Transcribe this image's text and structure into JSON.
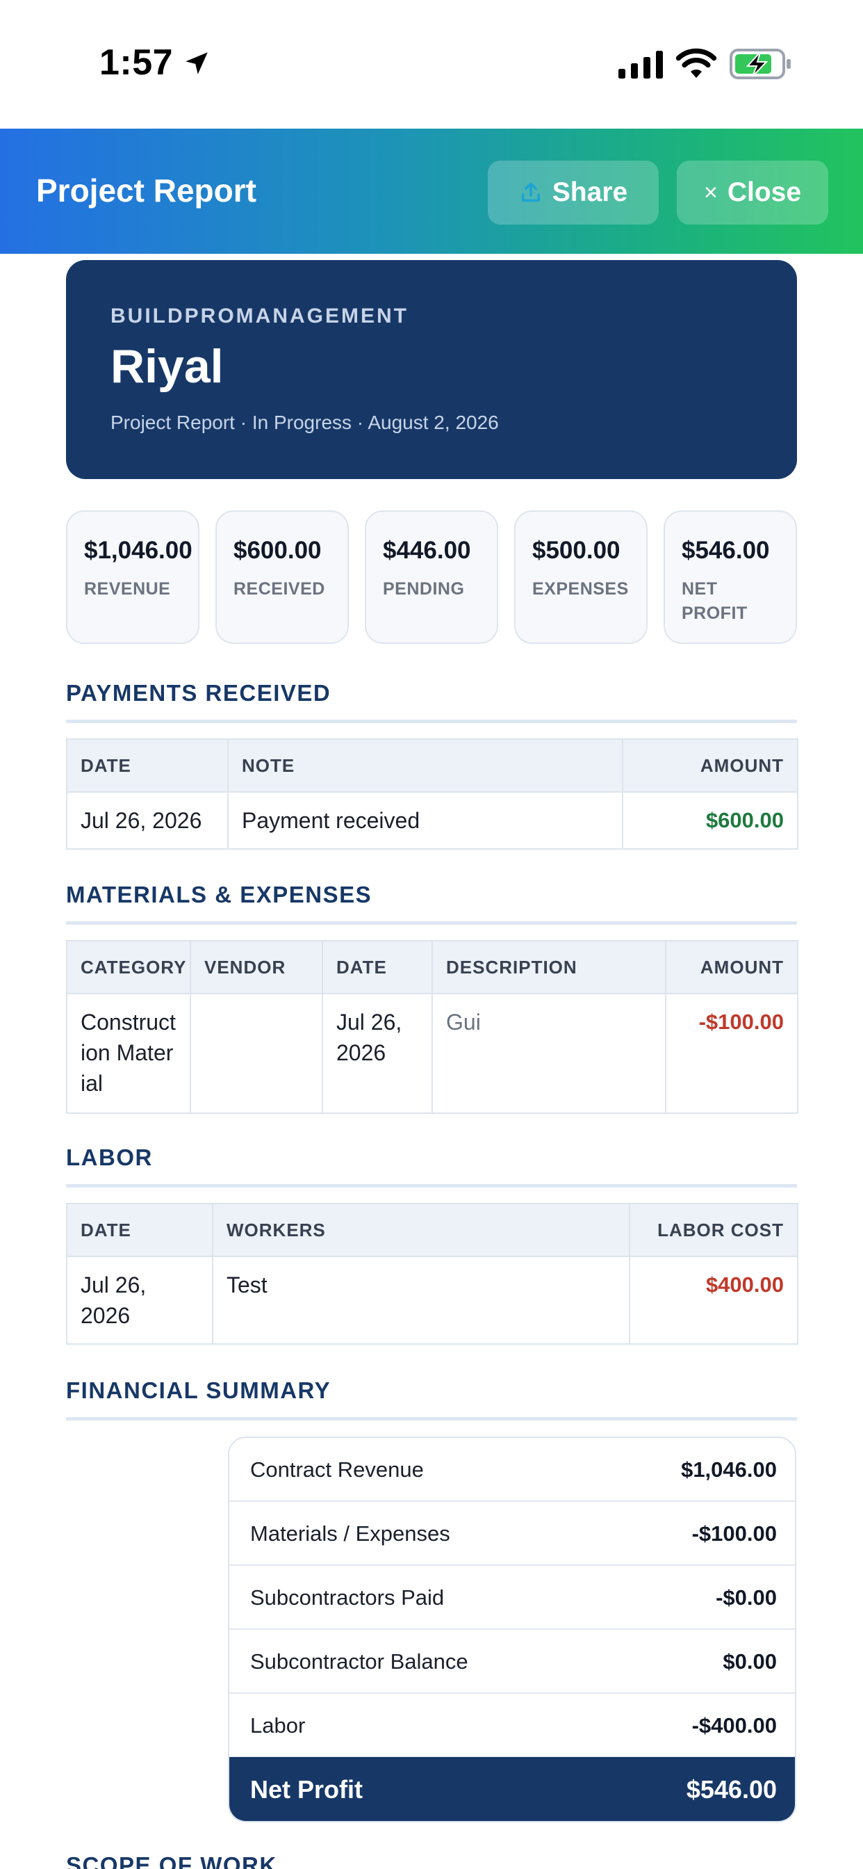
{
  "status_bar": {
    "time": "1:57"
  },
  "header": {
    "title": "Project Report",
    "share_label": "Share",
    "close_label": "Close",
    "close_glyph": "×"
  },
  "hero": {
    "org": "BUILDPROMANAGEMENT",
    "project_name": "Riyal",
    "meta": "Project Report · In Progress · August 2, 2026"
  },
  "stats": [
    {
      "value": "$1,046.00",
      "label": "REVENUE"
    },
    {
      "value": "$600.00",
      "label": "RECEIVED"
    },
    {
      "value": "$446.00",
      "label": "PENDING"
    },
    {
      "value": "$500.00",
      "label": "EXPENSES"
    },
    {
      "value": "$546.00",
      "label": "NET PROFIT"
    }
  ],
  "payments": {
    "title": "PAYMENTS RECEIVED",
    "columns": [
      "DATE",
      "NOTE",
      "AMOUNT"
    ],
    "rows": [
      {
        "date": "Jul 26, 2026",
        "note": "Payment received",
        "amount": "$600.00"
      }
    ]
  },
  "materials": {
    "title": "MATERIALS & EXPENSES",
    "columns": [
      "CATEGORY",
      "VENDOR",
      "DATE",
      "DESCRIPTION",
      "AMOUNT"
    ],
    "rows": [
      {
        "category": "Construction Material",
        "vendor": "",
        "date": "Jul 26, 2026",
        "description": "Gui",
        "amount": "-$100.00"
      }
    ]
  },
  "labor": {
    "title": "LABOR",
    "columns": [
      "DATE",
      "WORKERS",
      "LABOR COST"
    ],
    "rows": [
      {
        "date": "Jul 26, 2026",
        "workers": "Test",
        "cost": "$400.00"
      }
    ]
  },
  "financial_summary": {
    "title": "FINANCIAL SUMMARY",
    "rows": [
      {
        "label": "Contract Revenue",
        "value": "$1,046.00"
      },
      {
        "label": "Materials / Expenses",
        "value": "-$100.00"
      },
      {
        "label": "Subcontractors Paid",
        "value": "-$0.00"
      },
      {
        "label": "Subcontractor Balance",
        "value": "$0.00"
      },
      {
        "label": "Labor",
        "value": "-$400.00"
      }
    ],
    "total_label": "Net Profit",
    "total_value": "$546.00"
  },
  "scope_of_work": {
    "title": "SCOPE OF WORK"
  },
  "colors": {
    "header_start": "#2470e3",
    "header_end": "#22c35e",
    "navy": "#173867",
    "green": "#1e7a3e",
    "red": "#c0392b"
  },
  "icons": {
    "location": "location-arrow-icon",
    "signal": "cellular-signal-icon",
    "wifi": "wifi-icon",
    "battery": "battery-charging-icon",
    "share": "share-upload-icon"
  }
}
